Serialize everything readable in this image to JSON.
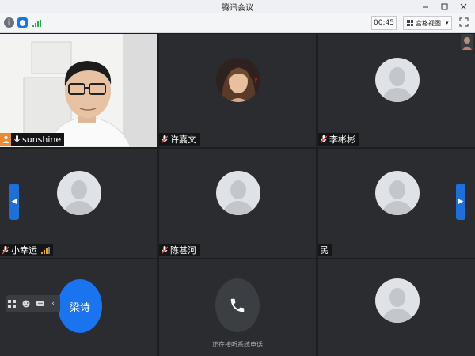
{
  "window": {
    "title": "腾讯会议"
  },
  "toolbar": {
    "timer": "00:45",
    "view_label": "宫格视图",
    "icons": [
      "info-icon",
      "shield-icon",
      "signal-icon"
    ]
  },
  "participants": [
    {
      "name": "sunshine",
      "video": true,
      "host": true
    },
    {
      "name": "许嘉文",
      "avatar": "photo"
    },
    {
      "name": "李彬彬",
      "avatar": "default"
    },
    {
      "name": "小幸运",
      "avatar": "default",
      "signal": true
    },
    {
      "name": "陈甚河",
      "avatar": "default"
    },
    {
      "name": "民",
      "avatar": "default"
    },
    {
      "name": "梁诗",
      "avatar": "initial-blue"
    },
    {
      "name": "",
      "avatar": "phone",
      "status": "正在接听系统电话"
    },
    {
      "name": "",
      "avatar": "default"
    }
  ],
  "colors": {
    "accent": "#1a73ef",
    "tile": "#2a2c30",
    "host_badge": "#f0892d"
  }
}
